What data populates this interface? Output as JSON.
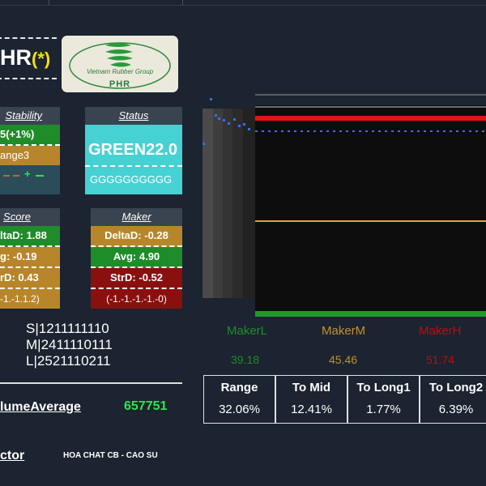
{
  "ticker": {
    "symbol": "HR",
    "flag": "(*)"
  },
  "logo": {
    "company": "Vietnam Rubber Group",
    "abbr": "PHR"
  },
  "stability": {
    "title": "Stability",
    "row1": "5(+1%)",
    "row2": "ange3",
    "marks": "– –  + –"
  },
  "status": {
    "title": "Status",
    "code": "GREEN22.0",
    "pattern": "GGGGGGGGGG"
  },
  "score": {
    "title": "Score",
    "delta": "ltaD: 1.88",
    "avg": "g: -0.19",
    "str": "rD: 0.43",
    "pattern": "-1.-1.1.2)"
  },
  "maker": {
    "title": "Maker",
    "delta": "DeltaD: -0.28",
    "avg": "Avg: 4.90",
    "str": "StrD: -0.52",
    "pattern": "(-1.-1.-1.-1.-0)"
  },
  "codes": {
    "s": "S|1211111110",
    "m": "M|2411110111",
    "l": "L|2521110211"
  },
  "volume": {
    "label": "lumeAverage",
    "value": "657751"
  },
  "sector": {
    "label": "ctor",
    "value": "HOA CHAT CB - CAO SU"
  },
  "makers": [
    {
      "label": "MakerL",
      "value": "39.18",
      "color": "#1f8c2a"
    },
    {
      "label": "MakerM",
      "value": "45.46",
      "color": "#c4912c"
    },
    {
      "label": "MakerH",
      "value": "51.74",
      "color": "#b80f0f"
    }
  ],
  "stats": [
    {
      "title": "Range",
      "value": "32.06%"
    },
    {
      "title": "To Mid",
      "value": "12.41%"
    },
    {
      "title": "To Long1",
      "value": "1.77%"
    },
    {
      "title": "To Long2",
      "value": "6.39%"
    }
  ],
  "colors": {
    "background": "#1b2430",
    "green": "#1f8c2a",
    "gold": "#b8862a",
    "red": "#8a1010",
    "teal": "#46d1d3",
    "value_green": "#2ee64b"
  }
}
